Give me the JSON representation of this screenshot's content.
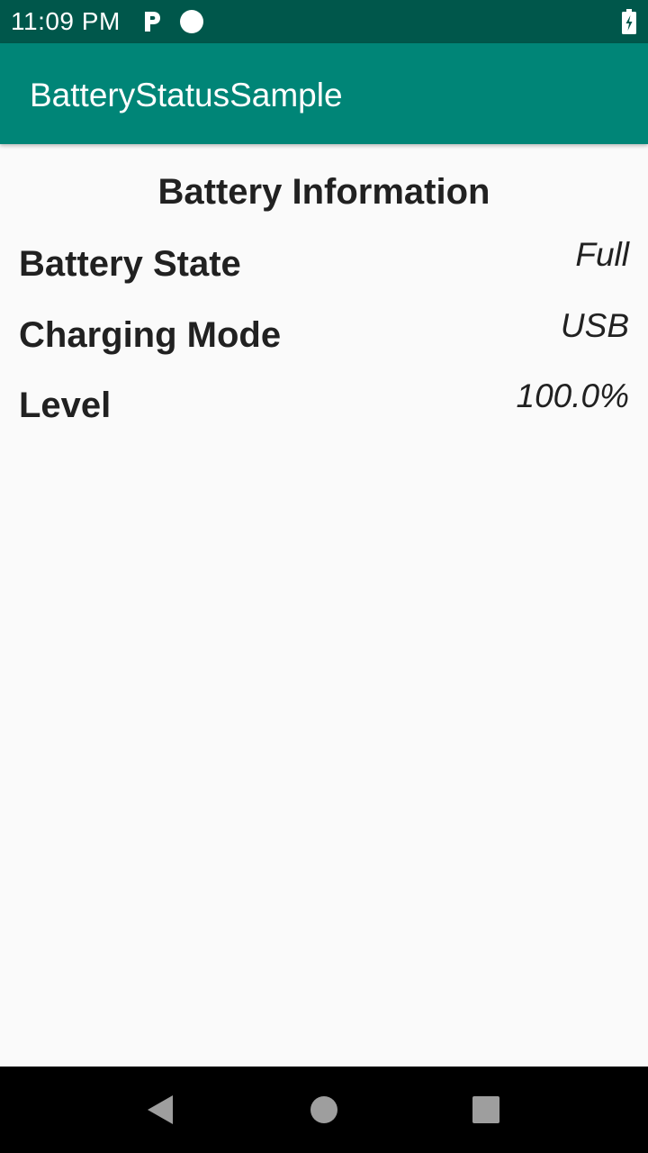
{
  "status_bar": {
    "time": "11:09 PM",
    "icons": [
      "parking-icon",
      "circle-notification-icon",
      "battery-charging-icon"
    ]
  },
  "app_bar": {
    "title": "BatteryStatusSample"
  },
  "main": {
    "section_title": "Battery Information",
    "rows": [
      {
        "label": "Battery State",
        "value": "Full"
      },
      {
        "label": "Charging Mode",
        "value": "USB"
      },
      {
        "label": "Level",
        "value": "100.0%"
      }
    ]
  },
  "nav_bar": {
    "icons": [
      "back-icon",
      "home-icon",
      "recents-icon"
    ]
  },
  "colors": {
    "status_bar": "#00574b",
    "app_bar": "#008577",
    "background": "#fafafa",
    "text": "#212121"
  }
}
